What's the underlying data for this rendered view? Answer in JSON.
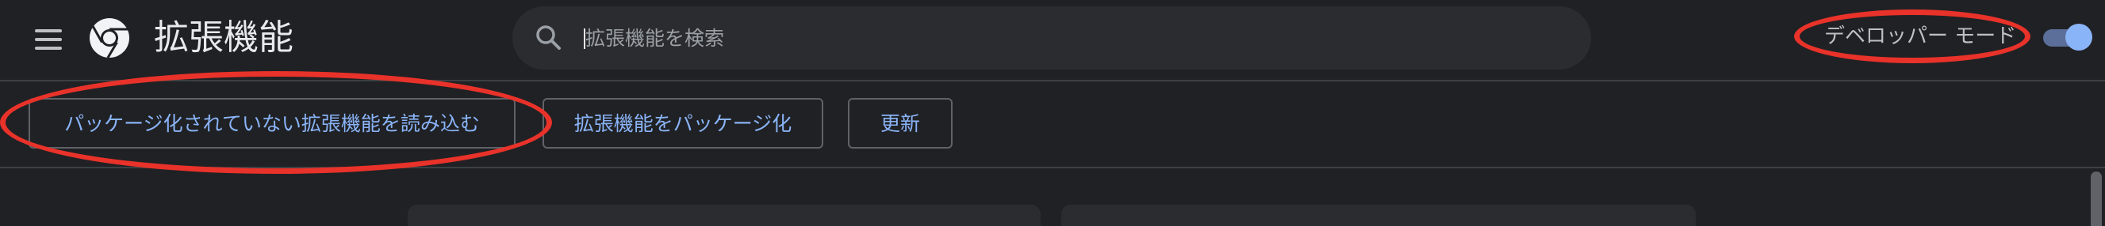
{
  "header": {
    "menu_icon": "hamburger-menu-icon",
    "logo_icon": "chrome-logo-icon",
    "title": "拡張機能",
    "search": {
      "placeholder": "拡張機能を検索",
      "value": "",
      "icon": "search-icon"
    },
    "developer_mode": {
      "label": "デベロッパー モード",
      "enabled": true
    }
  },
  "toolbar": {
    "load_unpacked_label": "パッケージ化されていない拡張機能を読み込む",
    "pack_extension_label": "拡張機能をパッケージ化",
    "update_label": "更新"
  },
  "colors": {
    "background": "#202124",
    "accent": "#8ab4f8",
    "highlight": "#e8322a",
    "text": "#e8eaed"
  }
}
